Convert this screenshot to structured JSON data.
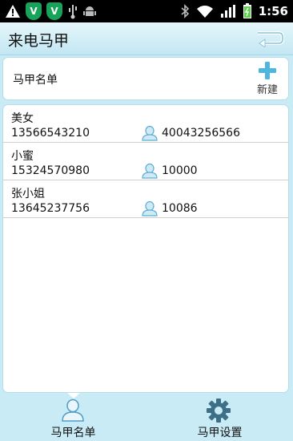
{
  "status_bar": {
    "time": "1:56",
    "shield_glyph": "V",
    "icons": [
      "warning-icon",
      "shield-icon",
      "shield-icon",
      "usb-icon",
      "android-icon",
      "bluetooth-icon",
      "wifi-icon",
      "signal-icon",
      "battery-icon"
    ]
  },
  "header": {
    "title": "来电马甲"
  },
  "list_header": {
    "title": "马甲名单",
    "new_label": "新建"
  },
  "contacts": [
    {
      "name": "美女",
      "phone": "13566543210",
      "alias": "40043256566"
    },
    {
      "name": "小蜜",
      "phone": "15324570980",
      "alias": "10000"
    },
    {
      "name": "张小姐",
      "phone": "13645237756",
      "alias": "10086"
    }
  ],
  "tabs": [
    {
      "label": "马甲名单",
      "icon": "person-icon",
      "selected": true
    },
    {
      "label": "马甲设置",
      "icon": "gear-icon",
      "selected": false
    }
  ],
  "colors": {
    "background": "#c9ebf5",
    "shield": "#17a45a",
    "accent": "#6fbfe0"
  }
}
